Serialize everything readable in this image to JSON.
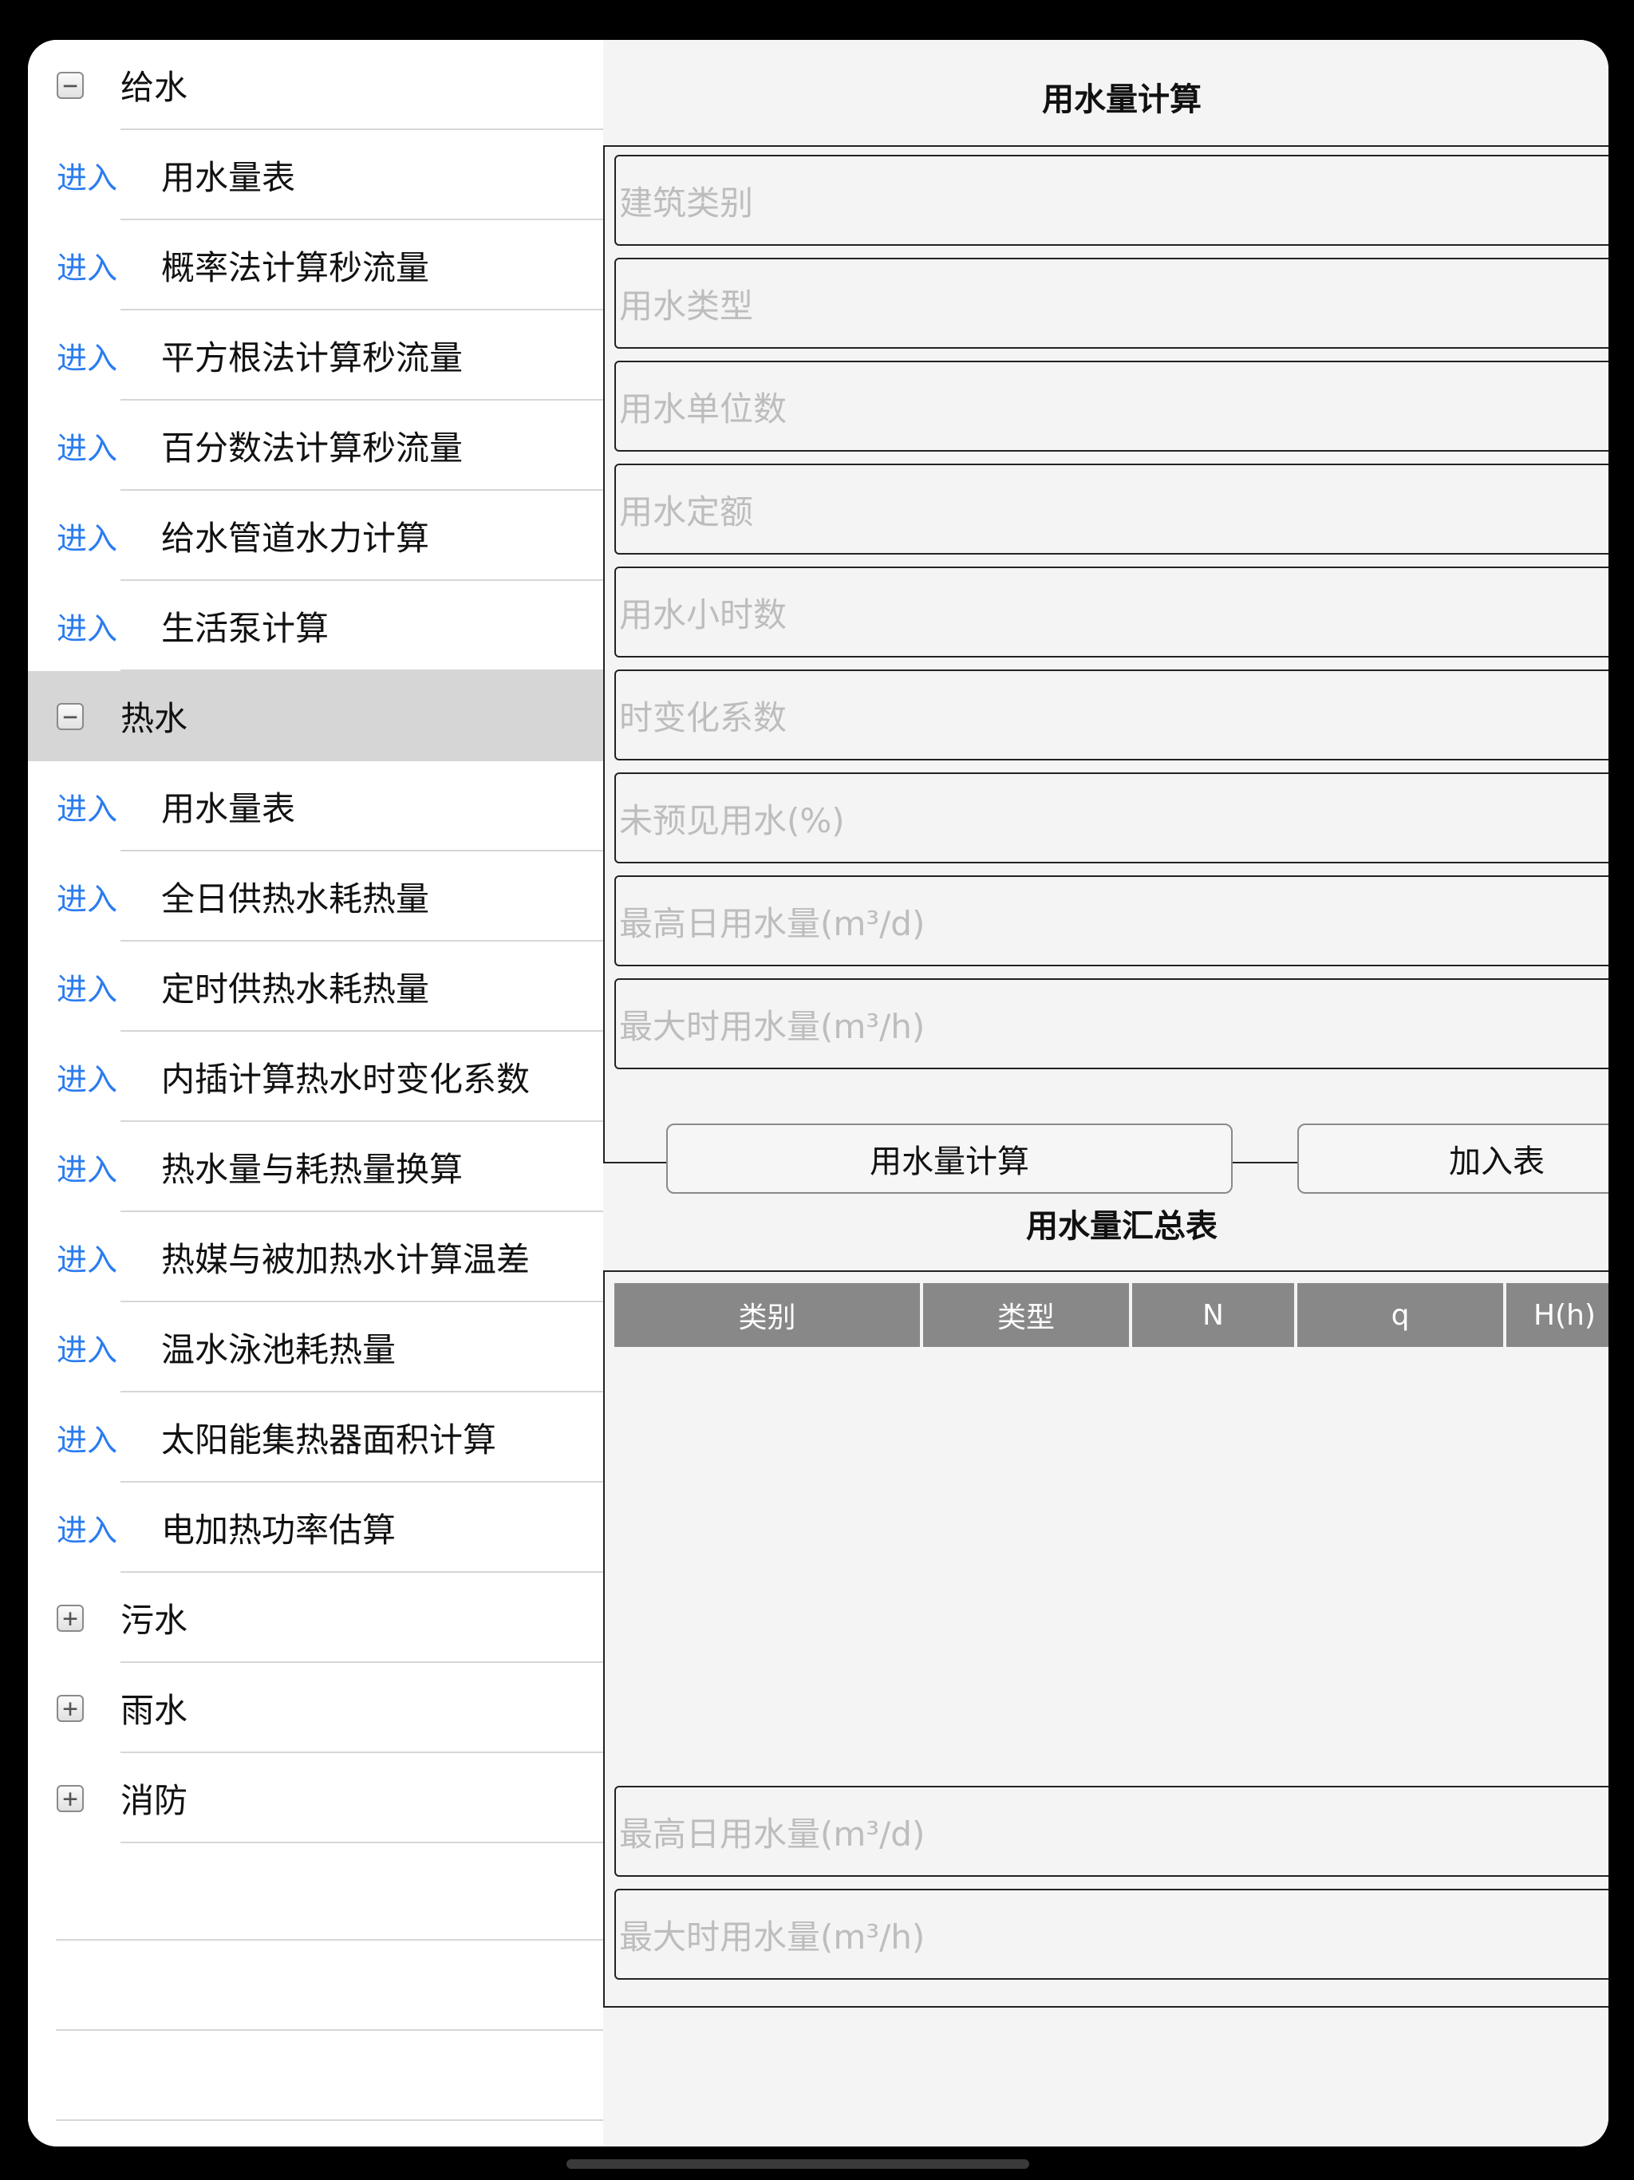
{
  "sidebar": {
    "categories": [
      {
        "toggle": "−",
        "label": "给水"
      },
      {
        "toggle": "−",
        "label": "热水"
      },
      {
        "toggle": "+",
        "label": "污水"
      },
      {
        "toggle": "+",
        "label": "雨水"
      },
      {
        "toggle": "+",
        "label": "消防"
      }
    ],
    "enter_label": "进入",
    "water_supply_items": [
      "用水量表",
      "概率法计算秒流量",
      "平方根法计算秒流量",
      "百分数法计算秒流量",
      "给水管道水力计算",
      "生活泵计算"
    ],
    "hot_water_items": [
      "用水量表",
      "全日供热水耗热量",
      "定时供热水耗热量",
      "内插计算热水时变化系数",
      "热水量与耗热量换算",
      "热媒与被加热水计算温差",
      "温水泳池耗热量",
      "太阳能集热器面积计算",
      "电加热功率估算"
    ]
  },
  "calc": {
    "title": "用水量计算",
    "fields": [
      "建筑类别",
      "用水类型",
      "用水单位数",
      "用水定额",
      "用水小时数",
      "时变化系数",
      "未预见用水(%)",
      "最高日用水量(m³/d)",
      "最大时用水量(m³/h)"
    ],
    "calc_button": "用水量计算",
    "add_button": "加入表"
  },
  "summary": {
    "title": "用水量汇总表",
    "columns": [
      "类别",
      "类型",
      "N",
      "q",
      "H(h)"
    ],
    "fields": [
      "最高日用水量(m³/d)",
      "最大时用水量(m³/h)"
    ]
  }
}
